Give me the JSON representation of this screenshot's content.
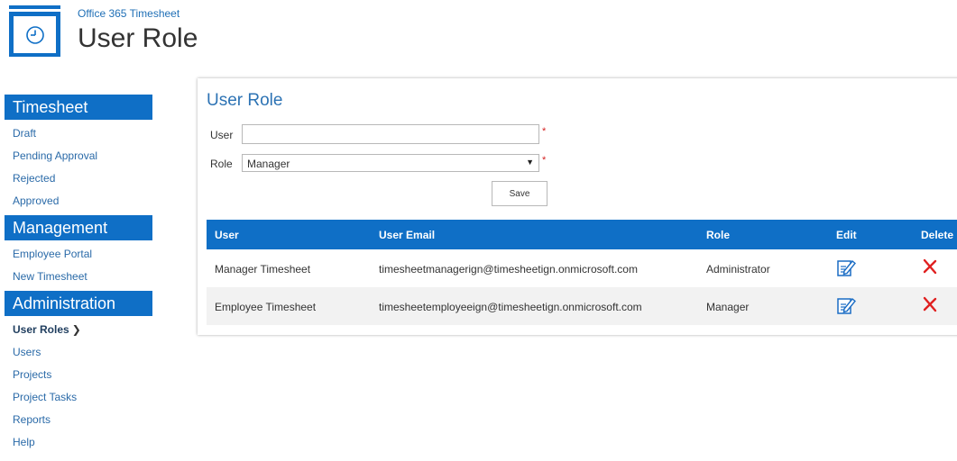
{
  "header": {
    "app_name": "Office 365 Timesheet",
    "page_title": "User Role",
    "logo_icon": "clock-icon"
  },
  "sidebar": {
    "sections": [
      {
        "title": "Timesheet",
        "items": [
          "Draft",
          "Pending Approval",
          "Rejected",
          "Approved"
        ]
      },
      {
        "title": "Management",
        "items": [
          "Employee Portal",
          "New Timesheet"
        ]
      },
      {
        "title": "Administration",
        "items": [
          "User Roles",
          "Users",
          "Projects",
          "Project Tasks",
          "Reports",
          "Help"
        ]
      }
    ],
    "active_item": "User Roles",
    "active_indicator": "chevron-right-icon"
  },
  "form": {
    "title": "User Role",
    "user_label": "User",
    "user_value": "",
    "role_label": "Role",
    "role_value": "Manager",
    "required_marker": "*",
    "save_label": "Save"
  },
  "table": {
    "headers": [
      "User",
      "User Email",
      "Role",
      "Edit",
      "Delete"
    ],
    "rows": [
      {
        "user": "Manager Timesheet",
        "email": "timesheetmanagerign@timesheetign.onmicrosoft.com",
        "role": "Administrator"
      },
      {
        "user": "Employee Timesheet",
        "email": "timesheetemployeeign@timesheetign.onmicrosoft.com",
        "role": "Manager"
      }
    ]
  },
  "colors": {
    "brand_blue": "#0f6fc6",
    "link_blue": "#2a6aa8",
    "required_red": "#d42020",
    "delete_red": "#e02020"
  }
}
